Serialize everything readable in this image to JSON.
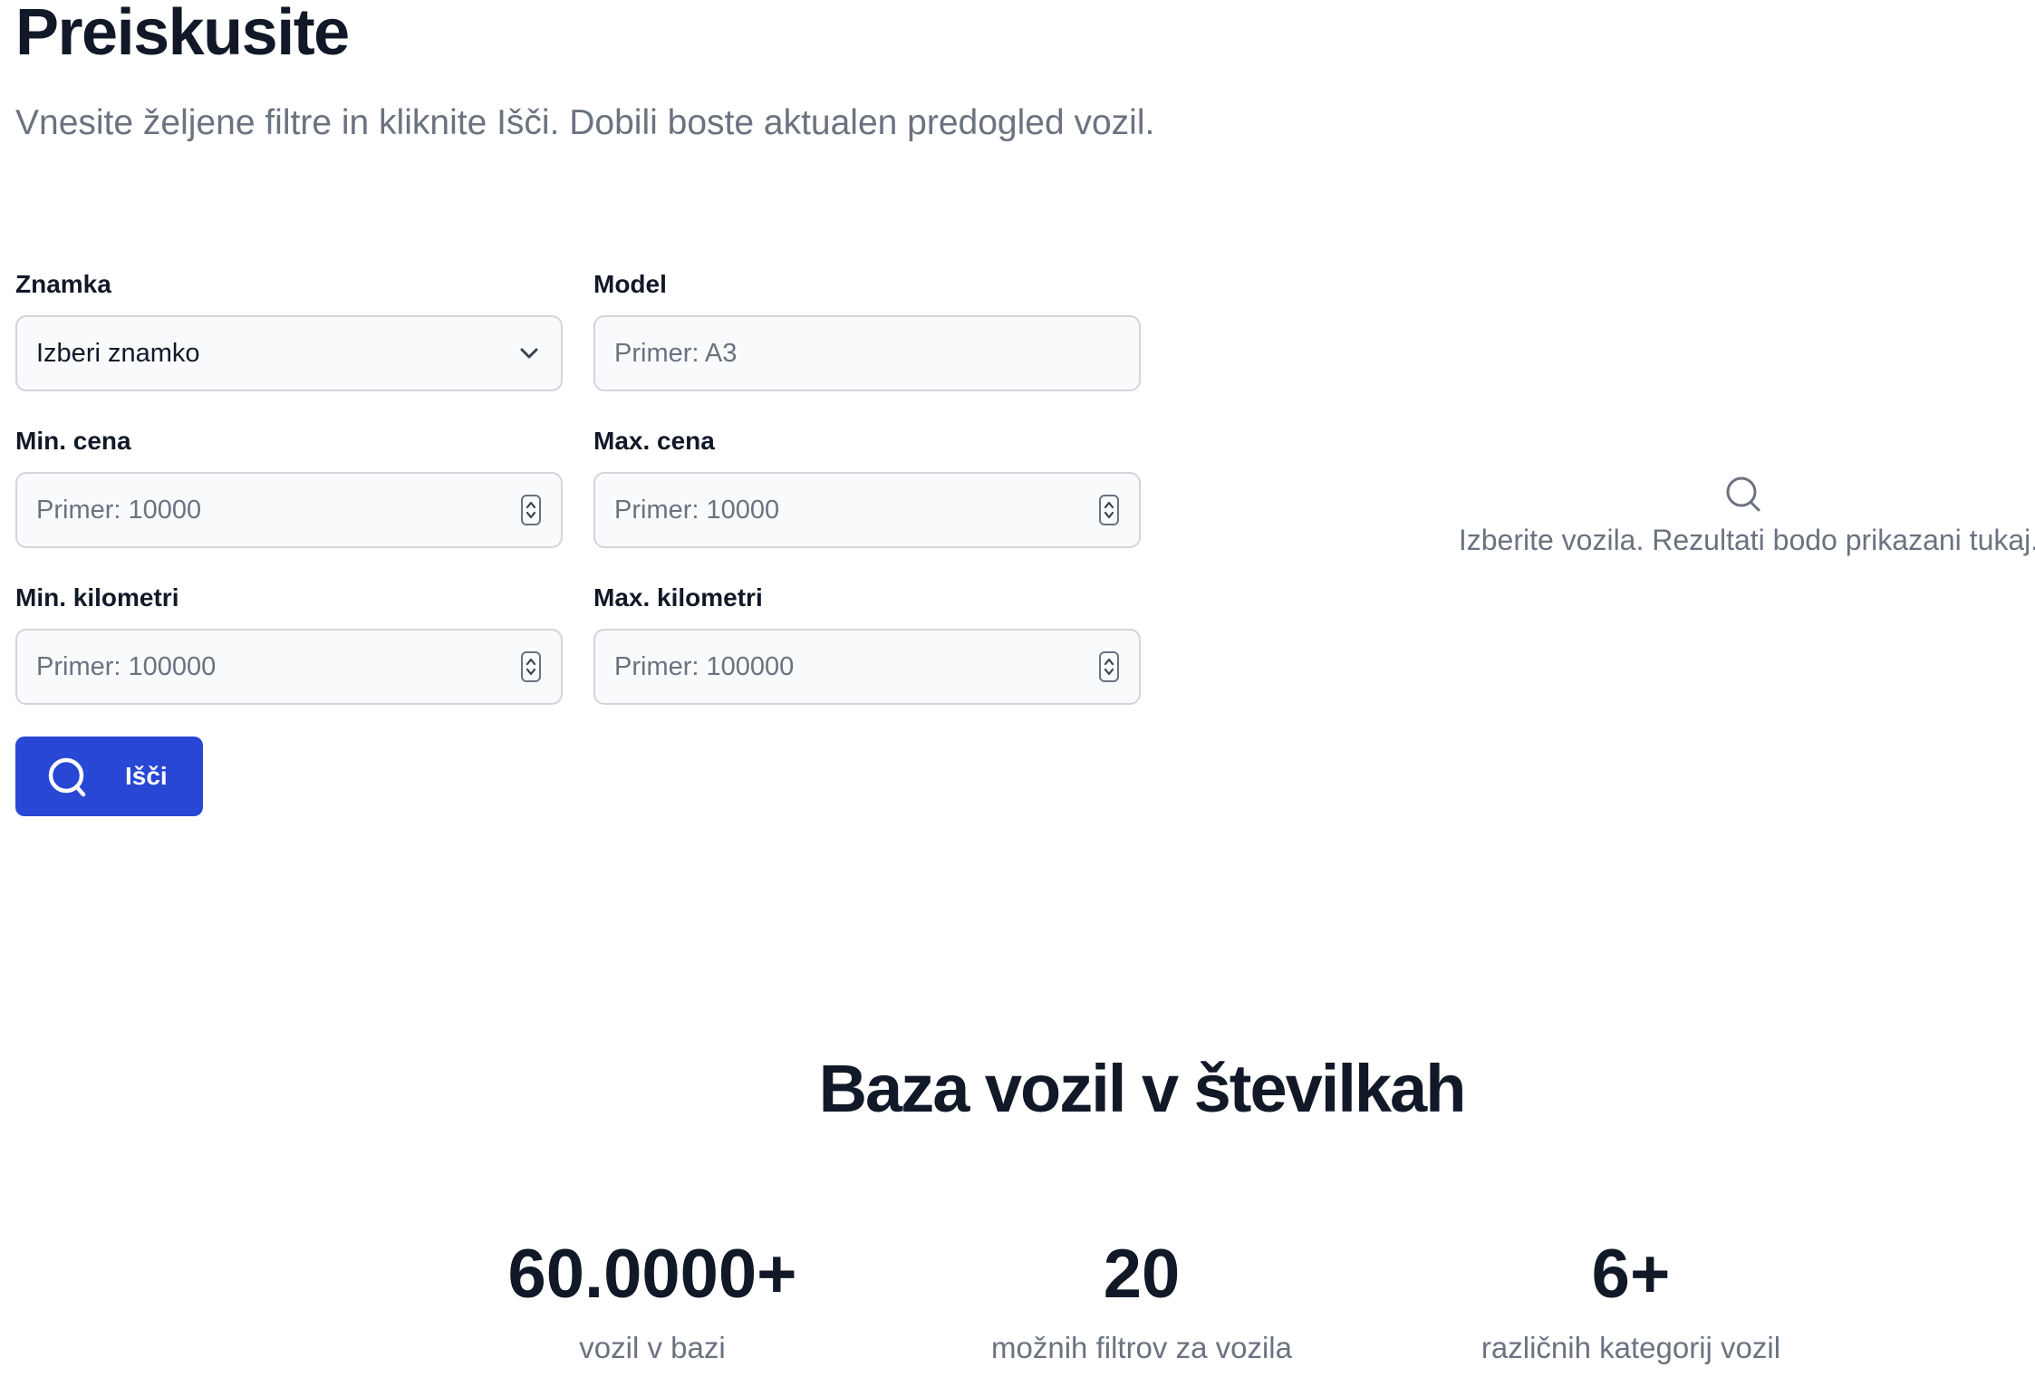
{
  "header": {
    "title": "Preiskusite",
    "subtitle": "Vnesite željene filtre in kliknite Išči. Dobili boste aktualen predogled vozil."
  },
  "form": {
    "brand": {
      "label": "Znamka",
      "value": "Izberi znamko",
      "icon": "chevron-down-icon"
    },
    "model": {
      "label": "Model",
      "placeholder": "Primer: A3"
    },
    "min_price": {
      "label": "Min. cena",
      "placeholder": "Primer: 10000",
      "icon": "stepper-icon"
    },
    "max_price": {
      "label": "Max. cena",
      "placeholder": "Primer: 10000",
      "icon": "stepper-icon"
    },
    "min_km": {
      "label": "Min. kilometri",
      "placeholder": "Primer: 100000",
      "icon": "stepper-icon"
    },
    "max_km": {
      "label": "Max. kilometri",
      "placeholder": "Primer: 100000",
      "icon": "stepper-icon"
    },
    "search_button": {
      "label": "Išči",
      "icon": "search-icon",
      "color": "#2747d4"
    }
  },
  "results": {
    "icon": "search-icon",
    "message": "Izberite vozila. Rezultati bodo prikazani tukaj."
  },
  "stats": {
    "title": "Baza vozil v številkah",
    "items": [
      {
        "value": "60.0000+",
        "label": "vozil v bazi"
      },
      {
        "value": "20",
        "label": "možnih filtrov za vozila"
      },
      {
        "value": "6+",
        "label": "različnih kategorij vozil"
      }
    ]
  },
  "colors": {
    "accent": "#2747d4",
    "text": "#111827",
    "muted": "#6b7280",
    "field_background": "#f9fafb",
    "field_border": "#d1d5db"
  }
}
